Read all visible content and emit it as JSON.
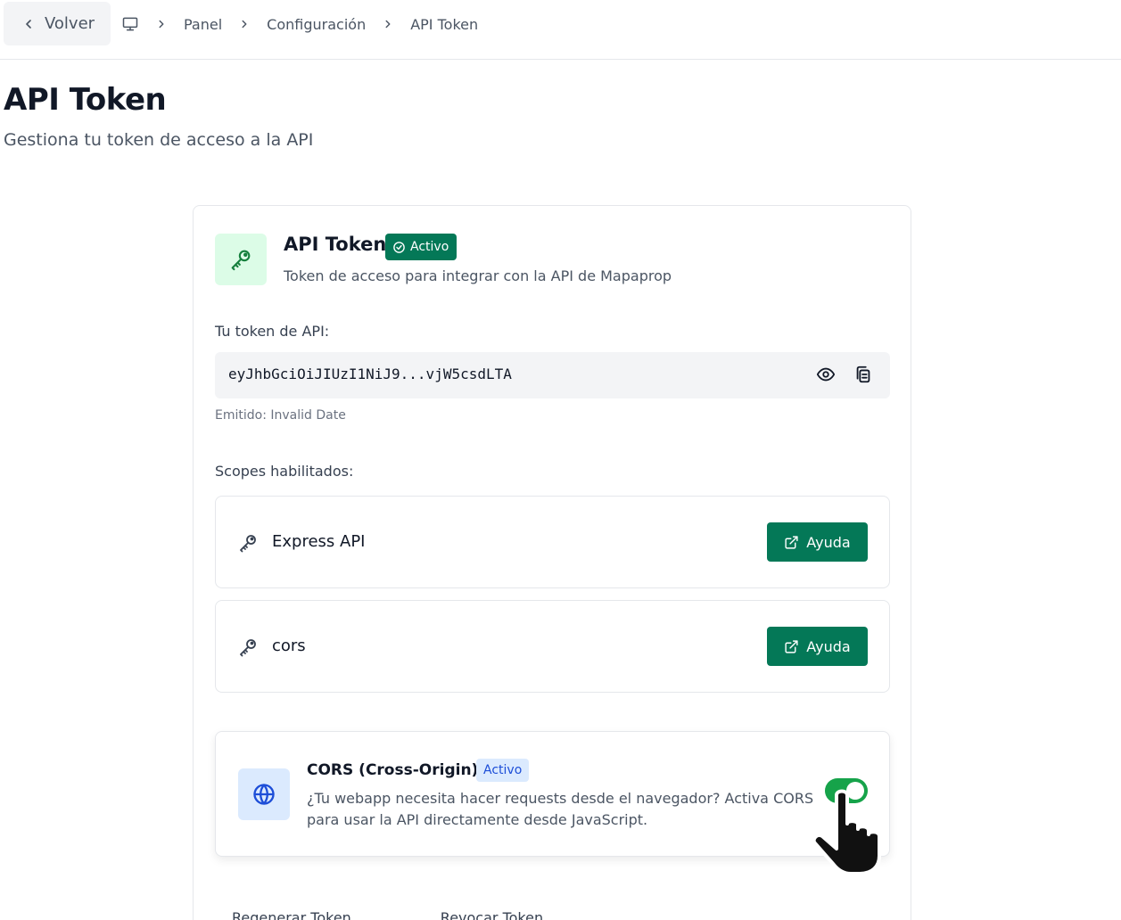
{
  "nav": {
    "back_label": "Volver",
    "breadcrumbs": [
      "Panel",
      "Configuración",
      "API Token"
    ]
  },
  "header": {
    "title": "API Token",
    "subtitle": "Gestiona tu token de acceso a la API"
  },
  "card": {
    "title": "API Token",
    "status_badge": "Activo",
    "description": "Token de acceso para integrar con la API de Mapaprop",
    "token_label": "Tu token de API:",
    "token_value": "eyJhbGciOiJIUzI1NiJ9...vjW5csdLTA",
    "emitted": "Emitido: Invalid Date",
    "scopes_label": "Scopes habilitados:",
    "scopes": [
      {
        "name": "Express API",
        "help_label": "Ayuda"
      },
      {
        "name": "cors",
        "help_label": "Ayuda"
      }
    ],
    "cors": {
      "title": "CORS (Cross-Origin)",
      "badge": "Activo",
      "description": "¿Tu webapp necesita hacer requests desde el navegador? Activa CORS para usar la API directamente desde JavaScript.",
      "enabled": true
    },
    "footer_actions": [
      "Regenerar Token",
      "Revocar Token"
    ]
  },
  "colors": {
    "accent_green": "#047857",
    "toggle_on": "#16a34a",
    "key_tile_bg": "#dcfce7",
    "globe_tile_bg": "#dbeafe"
  },
  "icons": [
    "chevron-left-icon",
    "monitor-icon",
    "chevron-right-icon",
    "key-icon",
    "check-circle-icon",
    "eye-icon",
    "copy-icon",
    "external-link-icon",
    "globe-icon",
    "hand-pointer-icon"
  ]
}
